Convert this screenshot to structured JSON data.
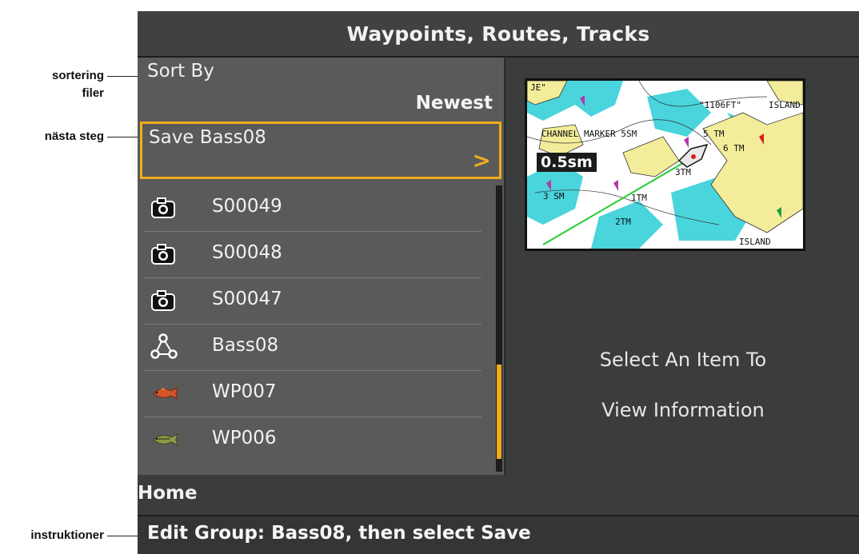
{
  "callouts": {
    "sort_line1": "sortering",
    "sort_line2": "filer",
    "next_step": "nästa steg",
    "instructions": "instruktioner"
  },
  "title": "Waypoints, Routes, Tracks",
  "sort": {
    "label": "Sort By",
    "value": "Newest"
  },
  "save_item": {
    "label": "Save Bass08",
    "chevron": ">"
  },
  "items": [
    {
      "name": "S00049",
      "icon": "camera-icon"
    },
    {
      "name": "S00048",
      "icon": "camera-icon"
    },
    {
      "name": "S00047",
      "icon": "camera-icon"
    },
    {
      "name": "Bass08",
      "icon": "route-icon"
    },
    {
      "name": "WP007",
      "icon": "red-fish-icon"
    },
    {
      "name": "WP006",
      "icon": "green-fish-icon"
    }
  ],
  "map": {
    "scale": "0.5sm"
  },
  "info": {
    "line1": "Select An Item To",
    "line2": "View Information"
  },
  "home": "Home",
  "instruction": "Edit Group: Bass08, then select Save",
  "colors": {
    "accent": "#f0ac1c",
    "panel": "#5a5a5a",
    "background": "#3a3d3c"
  }
}
